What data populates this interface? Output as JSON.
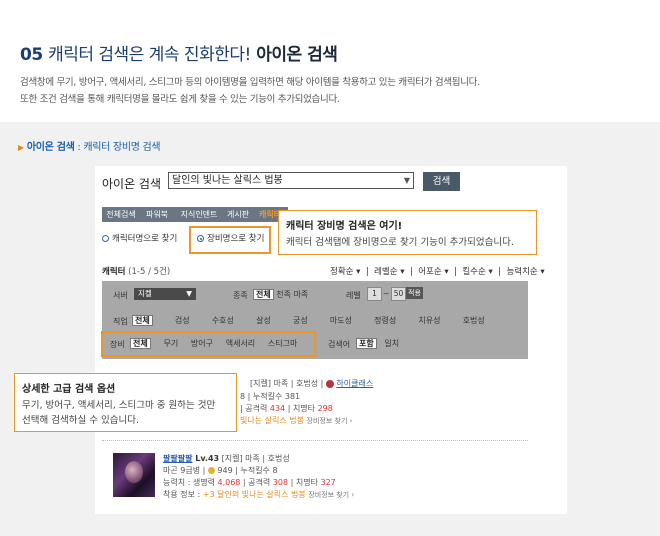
{
  "hero": {
    "number": "05",
    "title": "캐릭터 검색은 계속 진화한다!",
    "title_em": "아이온 검색",
    "desc_line1": "검색창에 무기, 방어구, 액세서리, 스티그마 등의 아이템명을 입력하면 해당 아이템을 착용하고 있는 캐릭터가 검색됩니다.",
    "desc_line2": "또한 조건 검색을 통해 캐릭터명을 몰라도 쉽게 찾을 수 있는 기능이 추가되었습니다."
  },
  "subhead": {
    "a": "아이온 검색",
    "sep": " : ",
    "b": "캐릭터 장비명 검색"
  },
  "search": {
    "label": "아이온 검색",
    "value": "달인의 빛나는 살릭스 법봉",
    "button": "검색"
  },
  "tabs": [
    {
      "label": "전체검색"
    },
    {
      "label": "파워북"
    },
    {
      "label": "지식인덴트"
    },
    {
      "label": "게시판"
    },
    {
      "label": "캐릭터"
    }
  ],
  "radio": {
    "by_name": "캐릭터명으로 찾기",
    "by_equip": "장비명으로 찾기"
  },
  "tooltip1": {
    "title": "캐릭터 장비명 검색은 여기!",
    "body": "캐릭터 검색탭에 장비명으로 찾기 기능이 추가되었습니다."
  },
  "results": {
    "title": "캐릭터",
    "count": "(1-5 / 5건)",
    "sort": [
      "정확순",
      "레벨순",
      "어포순",
      "킬수순",
      "능력치순"
    ]
  },
  "filters": {
    "server_label": "서버",
    "server_value": "지켈",
    "race_label": "종족",
    "race_options": [
      "전체",
      "천족",
      "마족"
    ],
    "level_label": "레벨",
    "level_from": "1",
    "level_to": "50",
    "level_btn": "적용",
    "job_label": "직업",
    "jobs": [
      "전체",
      "검성",
      "수호성",
      "살성",
      "궁성",
      "마도성",
      "정령성",
      "치유성",
      "호법성"
    ],
    "equip_label": "장비",
    "equips": [
      "전체",
      "무기",
      "방어구",
      "액세서리",
      "스티그마"
    ],
    "search_in_label": "검색어",
    "search_in": [
      "포함",
      "일치"
    ]
  },
  "tooltip2": {
    "title": "상세한 고급 검색 옵션",
    "body1": "무기, 방어구, 액세서리, 스티그마 중 원하는 것만",
    "body2": "선택해 검색하실 수 있습니다."
  },
  "row1": {
    "line1": "[지켈] 마족 | 호법성 | ",
    "legion": "하이클래스",
    "line2a": "8 | 누적킬수 381",
    "line3a": "| 공격력 ",
    "attack": "434",
    "line3b": " | 치명타 ",
    "crit": "298",
    "item": "빛나는 살릭스 법봉",
    "more": "장비정보 찾기 ›"
  },
  "row2": {
    "name": "팔팔팔팔",
    "level": " Lv.43",
    "server": "[지켈]",
    "race_job": " 마족 | 호법성",
    "rank": "마곤 9급병",
    "ap": "949",
    "kills": "누적킬수 8",
    "stats_label": "능력치 : 생명력 ",
    "hp": "4,068",
    "atk_label": " | 공격력 ",
    "atk": "308",
    "crit_label": " | 치명타 ",
    "crit": "327",
    "equip_label": "착용 정보 : ",
    "equip": "+3 달인의 빛나는 살릭스 법봉",
    "more": "장비정보 찾기 ›"
  }
}
